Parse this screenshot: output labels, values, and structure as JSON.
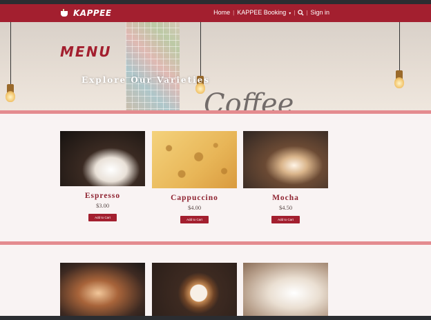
{
  "brand": {
    "name": "KAPPEE"
  },
  "nav": {
    "links": [
      "Home",
      "KAPPEE Booking",
      "Sign in"
    ],
    "separator": "|",
    "dropdown_caret": "▾"
  },
  "hero": {
    "title": "MENU",
    "subtitle": "Explore Our Varieties"
  },
  "menu": {
    "items": [
      {
        "name": "Espresso",
        "price": "$3.00",
        "button": "Add to Cart",
        "image": "espresso-pour"
      },
      {
        "name": "Cappuccino",
        "price": "$4.00",
        "button": "Add to Cart",
        "image": "cappuccino-foam"
      },
      {
        "name": "Mocha",
        "price": "$4.50",
        "button": "Add to Cart",
        "image": "mocha-whipped-cream"
      }
    ],
    "row2_images": [
      "iced-drink",
      "latte-art",
      "cups-with-cookies"
    ]
  },
  "colors": {
    "brand_red": "#a31f2f",
    "divider_pink": "#e48b8f",
    "section_bg": "#f9f3f3"
  }
}
